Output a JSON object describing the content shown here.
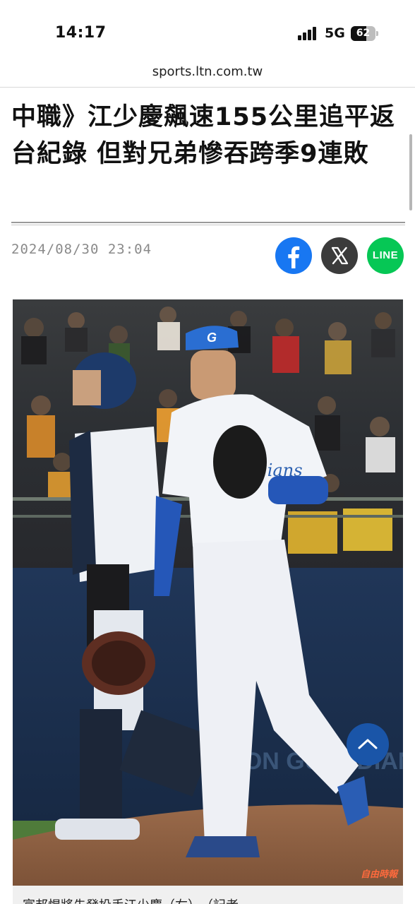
{
  "status_bar": {
    "time": "14:17",
    "network": "5G",
    "battery": "62",
    "battery_level": 0.62
  },
  "browser": {
    "url": "sports.ltn.com.tw"
  },
  "article": {
    "headline": "中職》江少慶飆速155公里追平返台紀錄 但對兄弟慘吞跨季9連敗",
    "date": "2024/08/30 23:04",
    "share": {
      "facebook_icon": "facebook-icon",
      "x_icon": "x-icon",
      "line_label": "LINE"
    },
    "photo": {
      "watermark": "自由時報",
      "cap_letter": "G",
      "jersey_script": "Guardians",
      "wall_text": "ON GUARDIANS"
    },
    "caption": "富邦悍將先發投手江少慶（右）。（記者"
  },
  "colors": {
    "facebook": "#1877f2",
    "x": "#3b3b3b",
    "line": "#06c755",
    "scroll_top": "#1a55a8"
  }
}
